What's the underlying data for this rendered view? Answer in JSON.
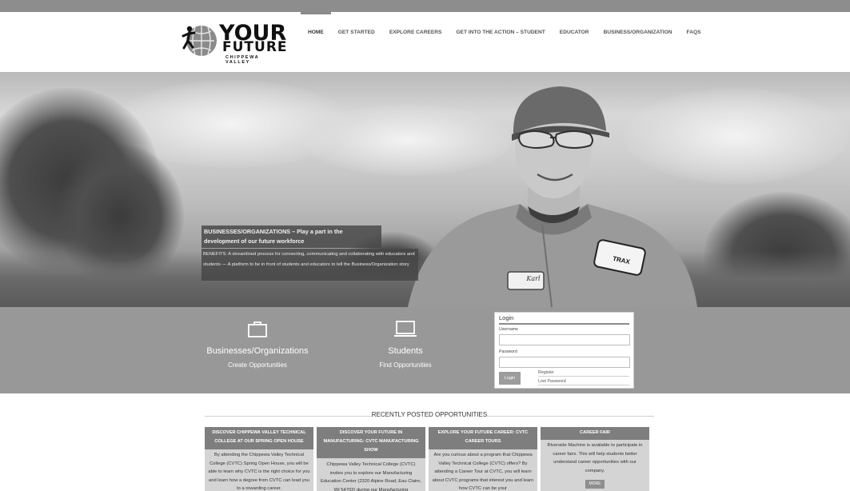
{
  "header": {
    "logo": {
      "word1": "YOUR",
      "word2": "FUTURE",
      "sub": "CHIPPEWA VALLEY"
    },
    "nav": [
      {
        "label": "HOME",
        "active": true
      },
      {
        "label": "GET STARTED"
      },
      {
        "label": "EXPLORE CAREERS"
      },
      {
        "label": "GET INTO THE ACTION – STUDENT"
      },
      {
        "label": "EDUCATOR"
      },
      {
        "label": "BUSINESS/ORGANIZATION"
      },
      {
        "label": "FAQS"
      }
    ]
  },
  "hero": {
    "title": "BUSINESSES/ORGANIZATIONS – Play a part in the development of our future workforce",
    "body": "BENEFITS:  A streamlined process for connecting, communicating and collaborating with educators and students — A platform to be in front of students and educators to tell the Business/Organization story",
    "name_patch": "Karl",
    "shirt_patch": "TRAX"
  },
  "band": {
    "businesses": {
      "title": "Businesses/Organizations",
      "link": "Create Opportunities",
      "icon": "briefcase-icon"
    },
    "students": {
      "title": "Students",
      "link": "Find Opportunities",
      "icon": "laptop-icon"
    }
  },
  "login": {
    "title": "Login",
    "username_label": "Username",
    "password_label": "Password",
    "button": "Login",
    "register": "Register",
    "lost_password": "Lost Password"
  },
  "recent": {
    "title": "RECENTLY POSTED OPPORTUNITIES",
    "cards": [
      {
        "title": "DISCOVER CHIPPEWA VALLEY TECHNICAL COLLEGE AT OUR SPRING OPEN HOUSE",
        "body": "By attending the Chippewa Valley Technical College (CVTC) Spring Open House, you will be able to learn why CVTC is the right choice for you and learn how a degree from CVTC can lead you to a rewarding career."
      },
      {
        "title": "DISCOVER YOUR FUTURE IN MANUFACTURING: CVTC MANUFACTURING SHOW",
        "body": "Chippewa Valley Technical College (CVTC) invites you to explore our Manufacturing Education Center (2320 Alpine Road, Eau Claire, WI 54703) during our Manufacturing"
      },
      {
        "title": "EXPLORE YOUR FUTURE CAREER: CVTC CAREER TOURS",
        "body": "Are you curious about a program that Chippewa Valley Technical College (CVTC) offers? By attending a Career Tour at CVTC, you will learn about CVTC programs that interest you and learn how CVTC can be your"
      },
      {
        "title": "CAREER FAIR",
        "body": "Riverside Machine is available to participate in career fairs. This will help students better understand career opportunities with our company.",
        "more": "MORE"
      }
    ]
  }
}
